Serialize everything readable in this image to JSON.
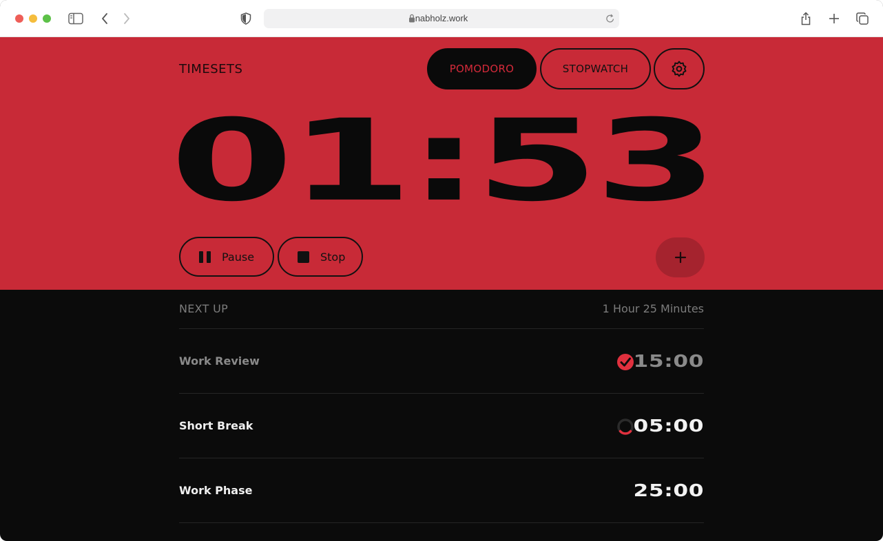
{
  "browser": {
    "url": "nabholz.work"
  },
  "app": {
    "brand": "TIMESETS",
    "modes": [
      {
        "label": "POMODORO",
        "active": true
      },
      {
        "label": "STOPWATCH",
        "active": false
      }
    ],
    "settings_icon": "gear-icon",
    "timer": "01:53",
    "controls": {
      "pause_label": "Pause",
      "stop_label": "Stop",
      "add_icon": "plus-icon"
    }
  },
  "queue": {
    "title": "NEXT UP",
    "total": "1 Hour 25 Minutes",
    "items": [
      {
        "label": "Work Review",
        "time": "15:00",
        "status": "completed"
      },
      {
        "label": "Short Break",
        "time": "05:00",
        "status": "in-progress"
      },
      {
        "label": "Work Phase",
        "time": "25:00",
        "status": "pending"
      }
    ]
  },
  "colors": {
    "accent_red": "#c82a37",
    "dark_bg": "#0b0b0b",
    "check_red": "#e0303e"
  }
}
